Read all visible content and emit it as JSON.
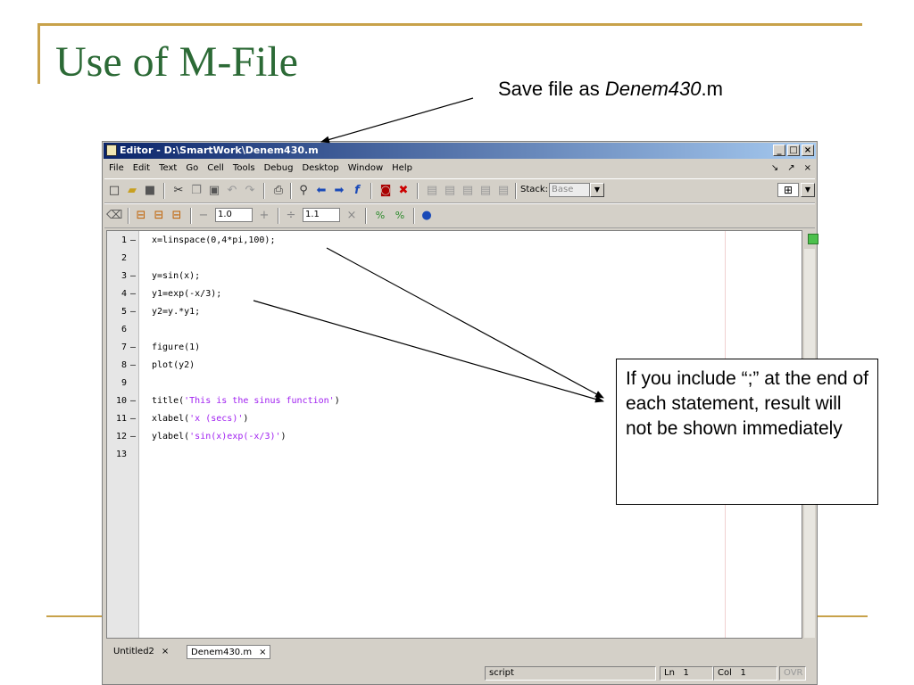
{
  "slide": {
    "title": "Use of M-File",
    "save_note_prefix": "Save file as ",
    "save_note_file": "Denem430",
    "save_note_ext": ".m",
    "callout": "If you include “;” at the end of each statement, result will not be shown immediately"
  },
  "editor": {
    "window_title": "Editor - D:\\SmartWork\\Denem430.m",
    "window_buttons": [
      "_",
      "□",
      "×"
    ],
    "menu": [
      "File",
      "Edit",
      "Text",
      "Go",
      "Cell",
      "Tools",
      "Debug",
      "Desktop",
      "Window",
      "Help"
    ],
    "menu_right": [
      "↘",
      "↗",
      "×"
    ],
    "toolbar1": {
      "icons": [
        "new-file-icon",
        "open-folder-icon",
        "save-icon",
        "cut-icon",
        "copy-icon",
        "paste-icon",
        "undo-icon",
        "redo-icon",
        "print-icon",
        "find-icon",
        "back-icon",
        "forward-icon",
        "function-icon",
        "set-breakpoint-icon",
        "clear-breakpoint-icon",
        "step-icon",
        "step-in-icon",
        "step-out-icon",
        "continue-icon",
        "exit-debug-icon"
      ],
      "stack_label": "Stack:",
      "stack_value": "Base"
    },
    "toolbar2": {
      "minus": "−",
      "field1": "1.0",
      "plus": "+",
      "divide": "÷",
      "field2": "1.1",
      "times": "×"
    },
    "code_lines": [
      {
        "num": "1",
        "bp": "–",
        "text": "x=linspace(0,4*pi,100);",
        "str": ""
      },
      {
        "num": "2",
        "bp": "",
        "text": "",
        "str": ""
      },
      {
        "num": "3",
        "bp": "–",
        "text": "y=sin(x);",
        "str": ""
      },
      {
        "num": "4",
        "bp": "–",
        "text": "y1=exp(-x/3);",
        "str": ""
      },
      {
        "num": "5",
        "bp": "–",
        "text": "y2=y.*y1;",
        "str": ""
      },
      {
        "num": "6",
        "bp": "",
        "text": "",
        "str": ""
      },
      {
        "num": "7",
        "bp": "–",
        "text": "figure(1)",
        "str": ""
      },
      {
        "num": "8",
        "bp": "–",
        "text": "plot(y2)",
        "str": ""
      },
      {
        "num": "9",
        "bp": "",
        "text": "",
        "str": ""
      },
      {
        "num": "10",
        "bp": "–",
        "text": "title(",
        "str": "'This is the sinus function'",
        "tail": ")"
      },
      {
        "num": "11",
        "bp": "–",
        "text": "xlabel(",
        "str": "'x (secs)'",
        "tail": ")"
      },
      {
        "num": "12",
        "bp": "–",
        "text": "ylabel(",
        "str": "'sin(x)exp(-x/3)'",
        "tail": ")"
      },
      {
        "num": "13",
        "bp": "",
        "text": "",
        "str": ""
      }
    ],
    "tabs": [
      {
        "label": "Untitled2",
        "close": "×"
      },
      {
        "label": "Denem430.m",
        "close": "×"
      }
    ],
    "status": {
      "mode": "script",
      "ln_label": "Ln",
      "ln": "1",
      "col_label": "Col",
      "col": "1",
      "ovr": "OVR"
    }
  },
  "colors": {
    "title_green": "#2c6a36",
    "frame_gold": "#c8a24a",
    "string_purple": "#a020f0"
  }
}
